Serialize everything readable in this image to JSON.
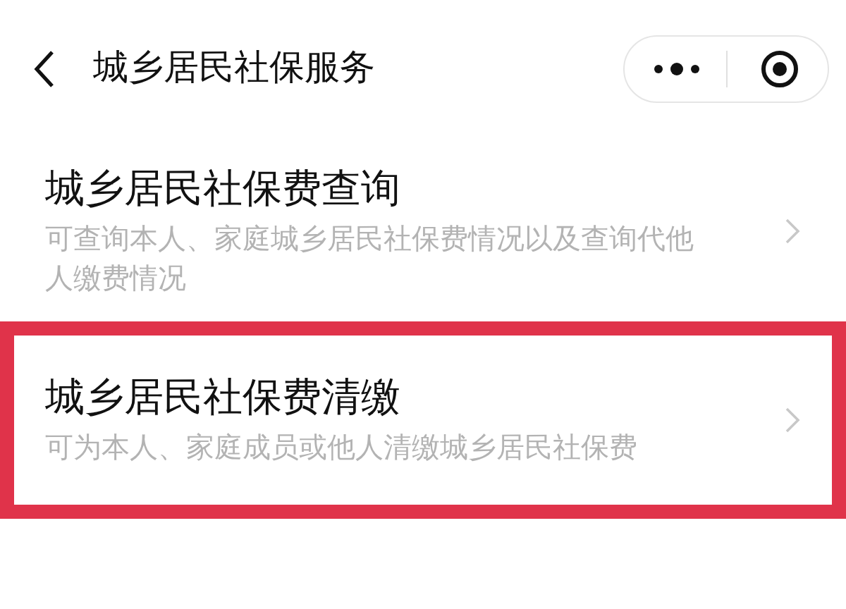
{
  "nav_bar": {
    "title": "城乡居民社保服务"
  },
  "items": [
    {
      "title": "城乡居民社保费查询",
      "description": "可查询本人、家庭城乡居民社保费情况以及查询代他人缴费情况",
      "highlighted": false
    },
    {
      "title": "城乡居民社保费清缴",
      "description": "可为本人、家庭成员或他人清缴城乡居民社保费",
      "highlighted": true
    }
  ]
}
